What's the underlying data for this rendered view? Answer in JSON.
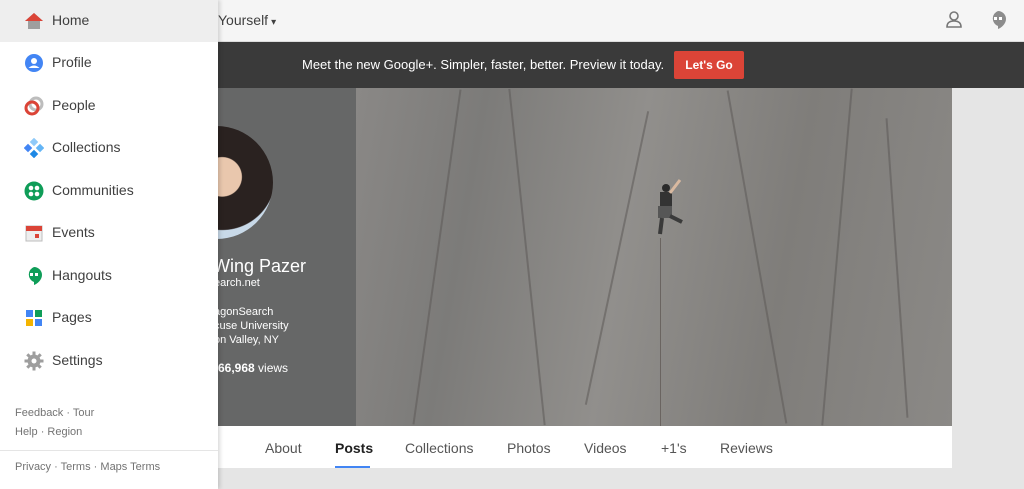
{
  "topbar": {
    "share_label": "Yourself",
    "caret": "▾"
  },
  "banner": {
    "text": "Meet the new Google+.   Simpler, faster, better. Preview it today.",
    "button": "Let's Go",
    "button_color": "#db4437"
  },
  "profile": {
    "name": "Wing Pazer",
    "site": "earch.net",
    "work": "agonSearch",
    "school": "cuse University",
    "location": "on Valley, NY",
    "views_count": "66,968",
    "views_label": "views"
  },
  "tabs": [
    "About",
    "Posts",
    "Collections",
    "Photos",
    "Videos",
    "+1's",
    "Reviews"
  ],
  "active_tab": "Posts",
  "sidebar": {
    "items": [
      {
        "label": "Home",
        "icon": "home-icon"
      },
      {
        "label": "Profile",
        "icon": "profile-icon"
      },
      {
        "label": "People",
        "icon": "people-icon"
      },
      {
        "label": "Collections",
        "icon": "collections-icon"
      },
      {
        "label": "Communities",
        "icon": "communities-icon"
      },
      {
        "label": "Events",
        "icon": "events-icon"
      },
      {
        "label": "Hangouts",
        "icon": "hangouts-icon"
      },
      {
        "label": "Pages",
        "icon": "pages-icon"
      },
      {
        "label": "Settings",
        "icon": "settings-icon"
      }
    ],
    "footer_links": {
      "feedback": "Feedback",
      "tour": "Tour",
      "help": "Help",
      "region": "Region",
      "privacy": "Privacy",
      "terms": "Terms",
      "maps_terms": "Maps Terms",
      "separator": "·"
    }
  }
}
